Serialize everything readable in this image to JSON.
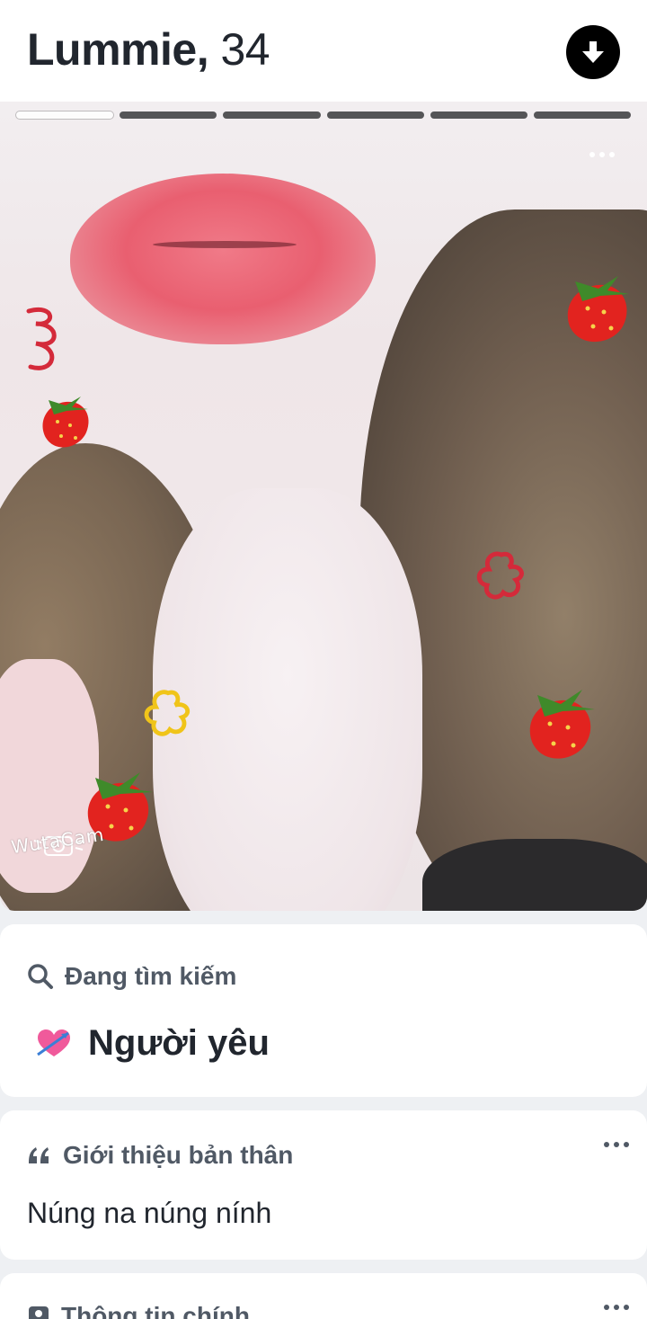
{
  "profile": {
    "name": "Lummie,",
    "age": "34"
  },
  "photo": {
    "total_photos": 6,
    "active_index": 0,
    "watermark": "WutaCam"
  },
  "looking_for": {
    "heading": "Đang tìm kiếm",
    "value": "Người yêu",
    "icon": "heart-with-arrow-icon"
  },
  "about": {
    "heading": "Giới thiệu bản thân",
    "text": "Núng na núng nính",
    "icon": "quote-icon"
  },
  "basic_info": {
    "heading": "Thông tin chính",
    "icon": "id-card-icon"
  },
  "colors": {
    "text_primary": "#21262e",
    "text_secondary": "#505965",
    "background": "#eef0f3"
  }
}
